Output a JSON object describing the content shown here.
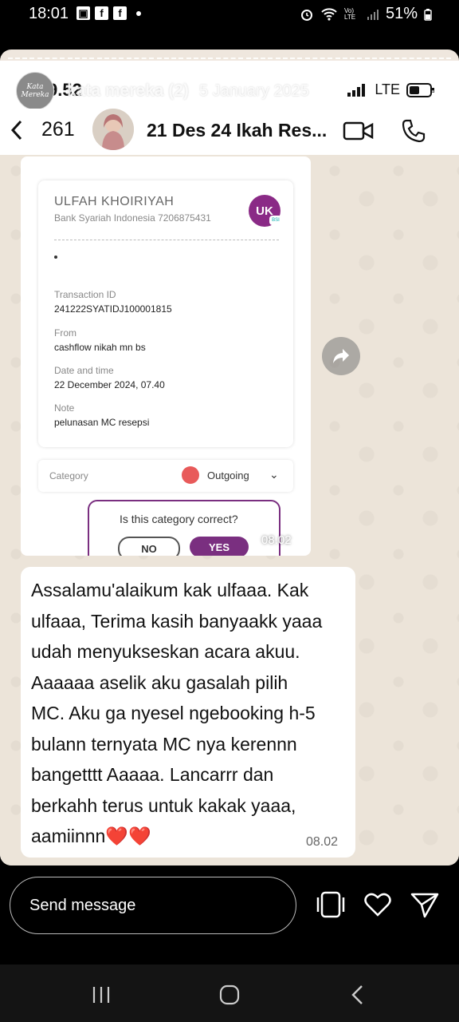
{
  "status_bar": {
    "time": "18:01",
    "battery": "51%",
    "volte": "Vo) LTE"
  },
  "story": {
    "avatar_text": "Kata Mereka",
    "username": "kata mereka (2)",
    "date": "5 January 2025"
  },
  "screenshot_phone": {
    "time": "9.52",
    "network": "LTE"
  },
  "chat_header": {
    "unread_count": "261",
    "contact_name": "21 Des 24 Ikah Res..."
  },
  "receipt": {
    "account_name": "ULFAH KHOIRIYAH",
    "bank_account": "Bank Syariah Indonesia 7206875431",
    "initials": "UK",
    "bank_badge": "BSI",
    "fields": [
      {
        "label": "Transaction ID",
        "value": "241222SYATIDJ100001815"
      },
      {
        "label": "From",
        "value": "cashflow nikah mn bs"
      },
      {
        "label": "Date and time",
        "value": "22 December 2024, 07.40"
      },
      {
        "label": "Note",
        "value": "pelunasan MC resepsi"
      }
    ],
    "category_label": "Category",
    "category_value": "Outgoing",
    "confirm_question": "Is this category correct?",
    "no_label": "NO",
    "yes_label": "YES",
    "image_time": "08.02"
  },
  "message": {
    "text": "Assalamu'alaikum kak ulfaaa. Kak\nulfaaa, Terima kasih banyaakk yaaa\nudah menyukseskan acara akuu.\nAaaaaa aselik aku gasalah pilih\nMC. Aku ga nyesel ngebooking h-5\nbulann ternyata MC nya kerennn\nbangetttt Aaaaa. Lancarrr dan\nberkahh terus untuk kakak yaaa,\naamiinnn❤️❤️",
    "time": "08.02"
  },
  "reply_bar": {
    "placeholder": "Send message"
  },
  "colors": {
    "accent_purple": "#7a2f80",
    "heart_red": "#d8232a"
  }
}
